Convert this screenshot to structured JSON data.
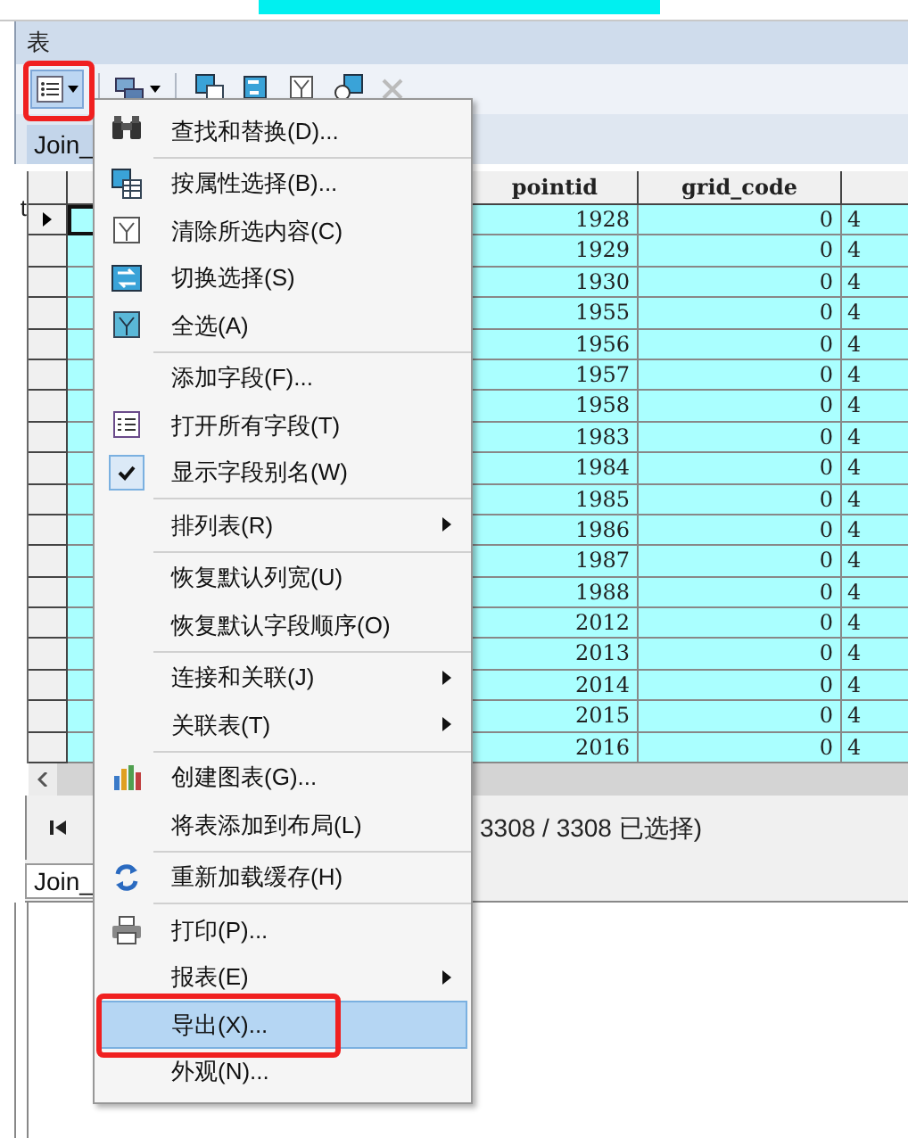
{
  "window": {
    "title": "表"
  },
  "table_tab": {
    "label": "Join_"
  },
  "left_fragment": "t",
  "table": {
    "columns": [
      "pointid",
      "grid_code"
    ],
    "rows": [
      {
        "pointid": "1928",
        "grid_code": "0",
        "column_3": "4",
        "current": true,
        "selected": true
      },
      {
        "pointid": "1929",
        "grid_code": "0",
        "column_3": "4",
        "current": false,
        "selected": true
      },
      {
        "pointid": "1930",
        "grid_code": "0",
        "column_3": "4",
        "current": false,
        "selected": true
      },
      {
        "pointid": "1955",
        "grid_code": "0",
        "column_3": "4",
        "current": false,
        "selected": true
      },
      {
        "pointid": "1956",
        "grid_code": "0",
        "column_3": "4",
        "current": false,
        "selected": true
      },
      {
        "pointid": "1957",
        "grid_code": "0",
        "column_3": "4",
        "current": false,
        "selected": true
      },
      {
        "pointid": "1958",
        "grid_code": "0",
        "column_3": "4",
        "current": false,
        "selected": true
      },
      {
        "pointid": "1983",
        "grid_code": "0",
        "column_3": "4",
        "current": false,
        "selected": true
      },
      {
        "pointid": "1984",
        "grid_code": "0",
        "column_3": "4",
        "current": false,
        "selected": true
      },
      {
        "pointid": "1985",
        "grid_code": "0",
        "column_3": "4",
        "current": false,
        "selected": true
      },
      {
        "pointid": "1986",
        "grid_code": "0",
        "column_3": "4",
        "current": false,
        "selected": true
      },
      {
        "pointid": "1987",
        "grid_code": "0",
        "column_3": "4",
        "current": false,
        "selected": true
      },
      {
        "pointid": "1988",
        "grid_code": "0",
        "column_3": "4",
        "current": false,
        "selected": true
      },
      {
        "pointid": "2012",
        "grid_code": "0",
        "column_3": "4",
        "current": false,
        "selected": true
      },
      {
        "pointid": "2013",
        "grid_code": "0",
        "column_3": "4",
        "current": false,
        "selected": true
      },
      {
        "pointid": "2014",
        "grid_code": "0",
        "column_3": "4",
        "current": false,
        "selected": true
      },
      {
        "pointid": "2015",
        "grid_code": "0",
        "column_3": "4",
        "current": false,
        "selected": true
      },
      {
        "pointid": "2016",
        "grid_code": "0",
        "column_3": "4",
        "current": false,
        "selected": true
      }
    ]
  },
  "record_count": "3308 / 3308 已选择)",
  "bottom_tab": {
    "label": "Join_"
  },
  "menu": {
    "items": [
      {
        "kind": "item",
        "label": "查找和替换(D)...",
        "checked": false,
        "submenu": false,
        "selected": false
      },
      {
        "kind": "separator"
      },
      {
        "kind": "item",
        "label": "按属性选择(B)...",
        "checked": false,
        "submenu": false,
        "selected": false
      },
      {
        "kind": "item",
        "label": "清除所选内容(C)",
        "checked": false,
        "submenu": false,
        "selected": false
      },
      {
        "kind": "item",
        "label": "切换选择(S)",
        "checked": false,
        "submenu": false,
        "selected": false
      },
      {
        "kind": "item",
        "label": "全选(A)",
        "checked": false,
        "submenu": false,
        "selected": false
      },
      {
        "kind": "separator"
      },
      {
        "kind": "item",
        "label": "添加字段(F)...",
        "checked": false,
        "submenu": false,
        "selected": false
      },
      {
        "kind": "item",
        "label": "打开所有字段(T)",
        "checked": false,
        "submenu": false,
        "selected": false
      },
      {
        "kind": "item",
        "label": "显示字段别名(W)",
        "checked": true,
        "submenu": false,
        "selected": false
      },
      {
        "kind": "separator"
      },
      {
        "kind": "item",
        "label": "排列表(R)",
        "checked": false,
        "submenu": true,
        "selected": false
      },
      {
        "kind": "separator"
      },
      {
        "kind": "item",
        "label": "恢复默认列宽(U)",
        "checked": false,
        "submenu": false,
        "selected": false
      },
      {
        "kind": "item",
        "label": "恢复默认字段顺序(O)",
        "checked": false,
        "submenu": false,
        "selected": false
      },
      {
        "kind": "separator"
      },
      {
        "kind": "item",
        "label": "连接和关联(J)",
        "checked": false,
        "submenu": true,
        "selected": false
      },
      {
        "kind": "item",
        "label": "关联表(T)",
        "checked": false,
        "submenu": true,
        "selected": false
      },
      {
        "kind": "separator"
      },
      {
        "kind": "item",
        "label": "创建图表(G)...",
        "checked": false,
        "submenu": false,
        "selected": false
      },
      {
        "kind": "item",
        "label": "将表添加到布局(L)",
        "checked": false,
        "submenu": false,
        "selected": false
      },
      {
        "kind": "separator"
      },
      {
        "kind": "item",
        "label": "重新加载缓存(H)",
        "checked": false,
        "submenu": false,
        "selected": false
      },
      {
        "kind": "separator"
      },
      {
        "kind": "item",
        "label": "打印(P)...",
        "checked": false,
        "submenu": false,
        "selected": false
      },
      {
        "kind": "item",
        "label": "报表(E)",
        "checked": false,
        "submenu": true,
        "selected": false
      },
      {
        "kind": "item",
        "label": "导出(X)...",
        "checked": false,
        "submenu": false,
        "selected": true
      },
      {
        "kind": "item",
        "label": "外观(N)...",
        "checked": false,
        "submenu": false,
        "selected": false
      }
    ]
  }
}
